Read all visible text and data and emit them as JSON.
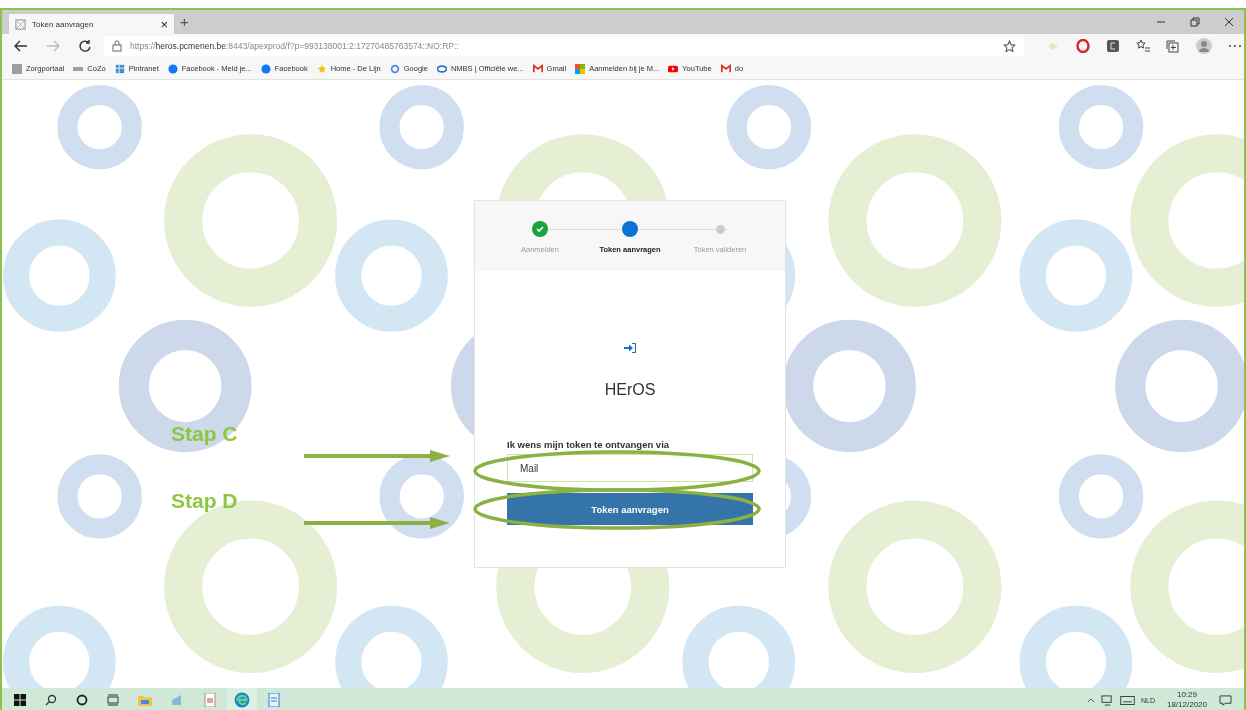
{
  "browser": {
    "tab": {
      "title": "Token aanvragen",
      "close": "×"
    },
    "new_tab": "+",
    "address": {
      "prefix": "https://",
      "host": "heros.pcmenen.be",
      "rest": ":8443/apexprod/f?p=993138001:2:17270485763574::NO:RP::"
    },
    "bookmarks": [
      {
        "label": "Zorgportaal",
        "kind": "page",
        "color": "#9e9e9e"
      },
      {
        "label": "CoZo",
        "kind": "dash",
        "color": "#9e9e9e"
      },
      {
        "label": "Pintranet",
        "kind": "grid",
        "color": "#3f8fd2"
      },
      {
        "label": "Facebook - Meld je...",
        "kind": "circle",
        "color": "#1877f2"
      },
      {
        "label": "Facebook",
        "kind": "circle",
        "color": "#1877f2"
      },
      {
        "label": "Home - De Lijn",
        "kind": "star",
        "color": "#f2c200"
      },
      {
        "label": "Google",
        "kind": "letter",
        "color": "#4285f4"
      },
      {
        "label": "NMBS | Officiële we...",
        "kind": "oval",
        "color": "#2a6fc9"
      },
      {
        "label": "Gmail",
        "kind": "mail",
        "color": "#d93025"
      },
      {
        "label": "Aanmelden bij je M...",
        "kind": "tiles",
        "color": "#f25022"
      },
      {
        "label": "YouTube",
        "kind": "play",
        "color": "#ff0000"
      },
      {
        "label": "do",
        "kind": "mail",
        "color": "#d93025"
      }
    ]
  },
  "steps": [
    {
      "label": "Aanmelden",
      "completed": true,
      "selected": false
    },
    {
      "label": "Token aanvragen",
      "completed": false,
      "selected": true
    },
    {
      "label": "Token valideren",
      "completed": false,
      "selected": false
    }
  ],
  "app_title": "HErOS",
  "field": {
    "label": "Ik wens mijn token te ontvangen via",
    "value": "Mail"
  },
  "submit": "Token aanvragen",
  "annotations": [
    {
      "label": "Stap C"
    },
    {
      "label": "Stap D"
    }
  ],
  "taskbar": {
    "language": "NLD",
    "time": "10:29",
    "date": "18/12/2020"
  }
}
